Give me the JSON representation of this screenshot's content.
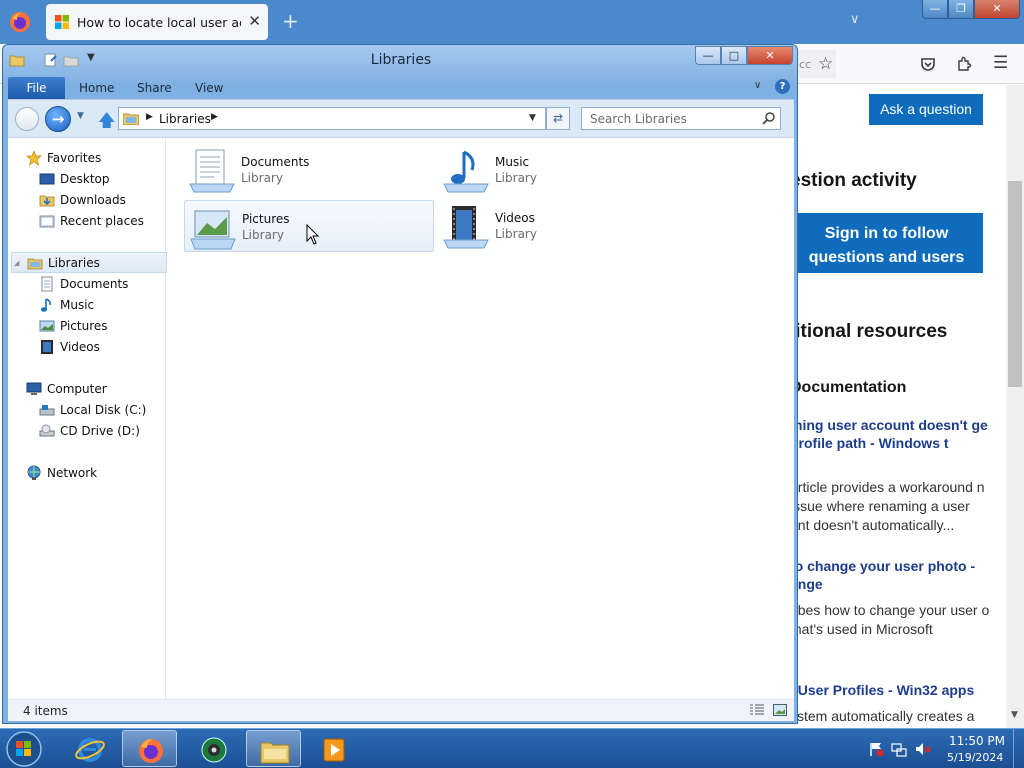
{
  "browser": {
    "tab_title": "How to locate local user accour",
    "tab_close": "✕",
    "new_tab": "+",
    "address_snippet": "cc"
  },
  "web": {
    "ask_button": "Ask a question",
    "question_activity": "estion activity",
    "signin_text": "Sign in to follow questions and users",
    "additional_resources": "litional resources",
    "documentation": "Documentation",
    "link1": "ming user account doesn't ge profile path - Windows t",
    "text1": "article provides a workaround n issue where renaming a user unt doesn't automatically...",
    "link2": "to change your user photo - ange",
    "text2": "ribes how to change your user o that's used in Microsoft",
    "link3": "l User Profiles - Win32 apps",
    "text3": "ystem automatically creates a"
  },
  "explorer": {
    "title": "Libraries",
    "ribbon_tabs": {
      "file": "File",
      "home": "Home",
      "share": "Share",
      "view": "View"
    },
    "address": "Libraries",
    "search_placeholder": "Search Libraries",
    "nav": {
      "favorites": "Favorites",
      "desktop": "Desktop",
      "downloads": "Downloads",
      "recent": "Recent places",
      "libraries": "Libraries",
      "documents": "Documents",
      "music": "Music",
      "pictures": "Pictures",
      "videos": "Videos",
      "computer": "Computer",
      "local_disk": "Local Disk (C:)",
      "cd_drive": "CD Drive (D:)",
      "network": "Network"
    },
    "items": [
      {
        "name": "Documents",
        "type": "Library"
      },
      {
        "name": "Music",
        "type": "Library"
      },
      {
        "name": "Pictures",
        "type": "Library"
      },
      {
        "name": "Videos",
        "type": "Library"
      }
    ],
    "status": "4 items"
  },
  "taskbar": {
    "time": "11:50 PM",
    "date": "5/19/2024"
  }
}
